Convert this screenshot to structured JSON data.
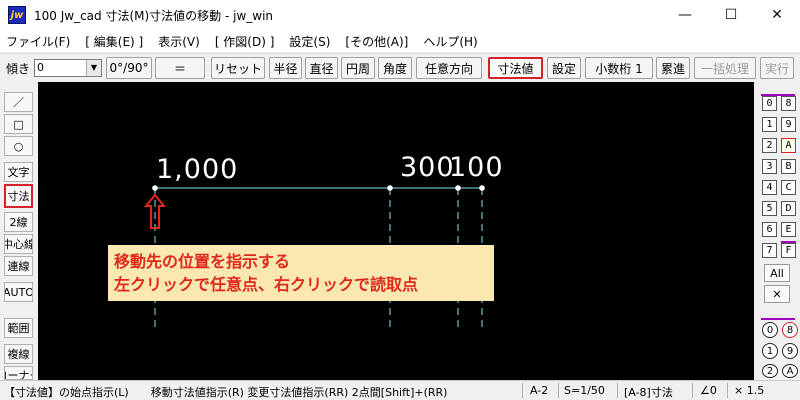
{
  "window": {
    "icon_text": "jw",
    "title": "100 Jw_cad 寸法(M)寸法値の移動 - jw_win",
    "minimize": "—",
    "maximize": "☐",
    "close": "✕"
  },
  "menu": [
    "ファイル(F)",
    "[ 編集(E) ]",
    "表示(V)",
    "[ 作図(D) ]",
    "設定(S)",
    "[その他(A)]",
    "ヘルプ(H)"
  ],
  "toolbar": {
    "angle_label": "傾き",
    "angle_value": "0",
    "buttons": {
      "angle_toggle": "0°/90°",
      "equal": "＝",
      "reset": "リセット",
      "radius": "半径",
      "diameter": "直径",
      "circumference": "円周",
      "angle": "角度",
      "any_direction": "任意方向",
      "dim_value": "寸法値",
      "settings": "設定",
      "decimals": "小数桁 1",
      "cumulative": "累進",
      "batch": "一括処理",
      "execute": "実行"
    }
  },
  "left_tools": {
    "line": "／",
    "rect": "□",
    "circle": "○",
    "text": "文字",
    "dimension": "寸法",
    "double_line": "2線",
    "center_line": "中心線",
    "continuous_line": "連線",
    "auto": "AUTO",
    "range": "範囲",
    "copy": "複線",
    "corner": "コーナー"
  },
  "canvas": {
    "dimension_values": [
      "1,000",
      "300",
      "100"
    ],
    "callout_line1": "移動先の位置を指示する",
    "callout_line2": "左クリックで任意点、右クリックで読取点"
  },
  "layers": {
    "left_col": [
      "0",
      "1",
      "2",
      "3",
      "4",
      "5",
      "6",
      "7"
    ],
    "right_col": [
      "8",
      "9",
      "A",
      "B",
      "C",
      "D",
      "E",
      "F"
    ],
    "all": "All",
    "cross": "✕",
    "group_left": [
      "0",
      "1",
      "2"
    ],
    "group_right": [
      "8",
      "9",
      "A"
    ]
  },
  "status": {
    "prompt": "【寸法値】の始点指示(L)　　移動寸法値指示(R) 変更寸法値指示(RR) 2点間[Shift]+(RR)",
    "paper": "A-2",
    "scale": "S=1/50",
    "layer": "[A-8]寸法",
    "angle": "∠0",
    "factor": "× 1.5"
  }
}
